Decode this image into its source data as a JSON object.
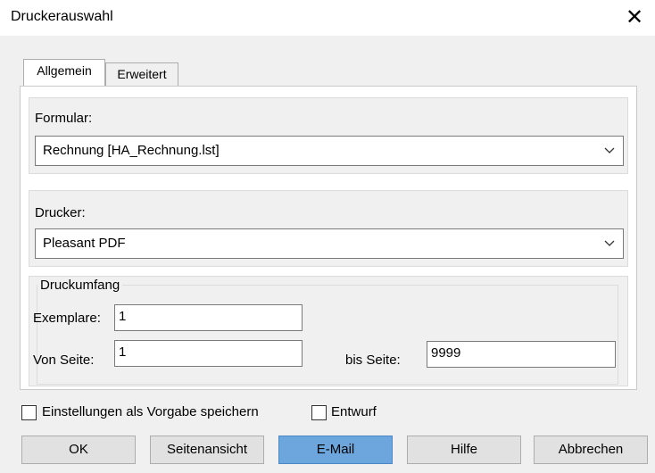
{
  "window": {
    "title": "Druckerauswahl",
    "close_glyph": "✕"
  },
  "tabs": [
    {
      "label": "Allgemein",
      "active": true
    },
    {
      "label": "Erweitert",
      "active": false
    }
  ],
  "formular": {
    "label": "Formular:",
    "value": "Rechnung [HA_Rechnung.lst]"
  },
  "drucker": {
    "label": "Drucker:",
    "value": "Pleasant PDF"
  },
  "druckumfang": {
    "legend": "Druckumfang",
    "exemplare_label": "Exemplare:",
    "exemplare_value": "1",
    "von_seite_label": "Von Seite:",
    "von_seite_value": "1",
    "bis_seite_label": "bis Seite:",
    "bis_seite_value": "9999"
  },
  "options": {
    "save_default_label": "Einstellungen als Vorgabe speichern",
    "save_default_checked": false,
    "entwurf_label": "Entwurf",
    "entwurf_checked": false
  },
  "buttons": {
    "ok": "OK",
    "preview": "Seitenansicht",
    "email": "E-Mail",
    "help": "Hilfe",
    "cancel": "Abbrechen"
  },
  "colors": {
    "primary_button": "#6ca6dd",
    "dialog_bg": "#f0f0f0"
  }
}
